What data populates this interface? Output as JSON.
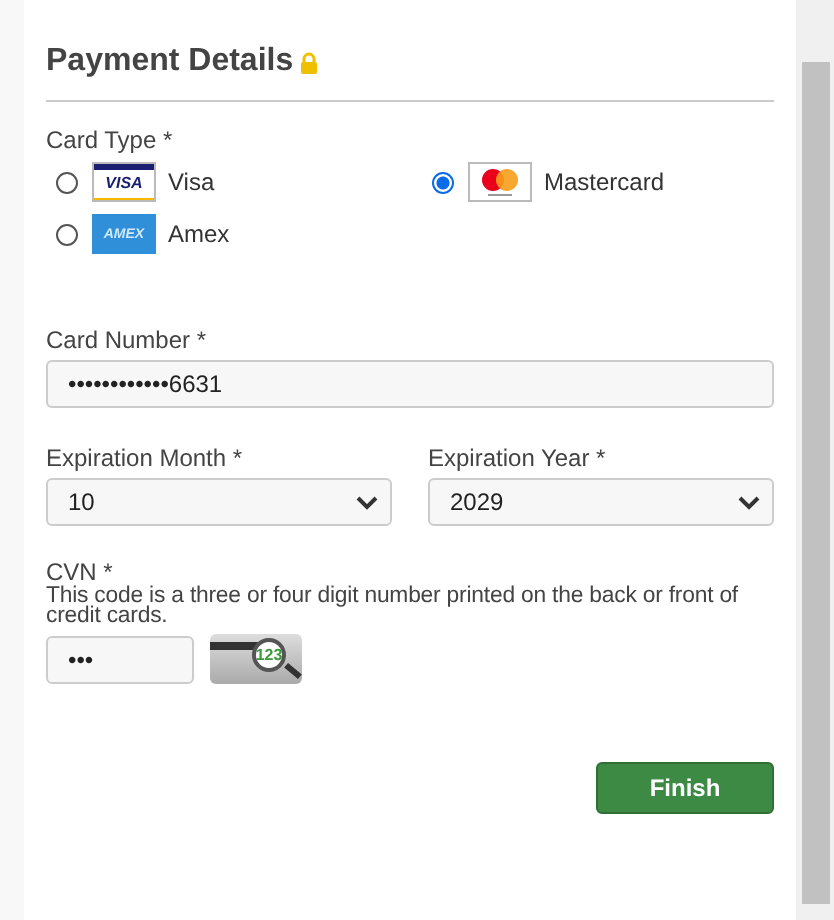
{
  "title": "Payment Details",
  "card_type": {
    "label": "Card Type *",
    "options": [
      {
        "kind": "visa",
        "label": "Visa",
        "logo_text": "VISA",
        "selected": false
      },
      {
        "kind": "mastercard",
        "label": "Mastercard",
        "selected": true
      },
      {
        "kind": "amex",
        "label": "Amex",
        "logo_text": "AMEX",
        "selected": false
      }
    ]
  },
  "card_number": {
    "label": "Card Number *",
    "value": "••••••••••••6631"
  },
  "expiration_month": {
    "label": "Expiration Month *",
    "value": "10"
  },
  "expiration_year": {
    "label": "Expiration Year *",
    "value": "2029"
  },
  "cvn": {
    "label": "CVN *",
    "help": "This code is a three or four digit number printed on the back or front of credit cards.",
    "value": "•••",
    "icon_text": "123"
  },
  "finish_button": "Finish"
}
